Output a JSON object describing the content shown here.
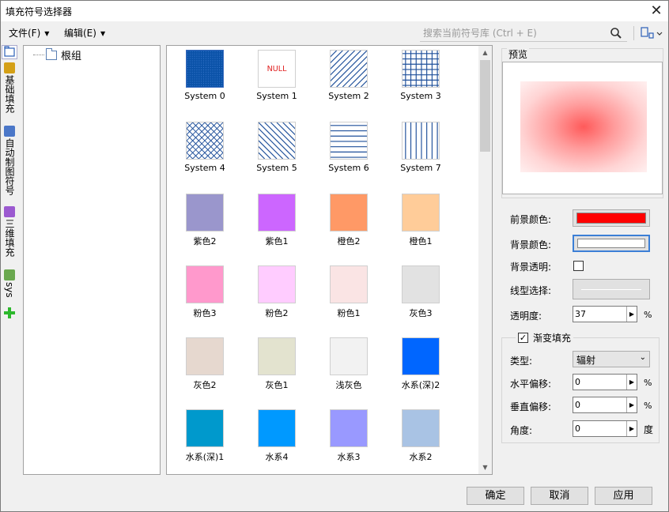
{
  "window": {
    "title": "填充符号选择器",
    "close_glyph": "✕"
  },
  "menu": {
    "file": "文件(F)",
    "edit": "编辑(E)"
  },
  "search": {
    "placeholder": "搜索当前符号库 (Ctrl + E)"
  },
  "vtabs": [
    {
      "label": "基础填充",
      "icon": "pattern-fill-icon",
      "color": "#d4a017"
    },
    {
      "label": "自动制图符号",
      "icon": "map-symbol-icon",
      "color": "#4b77c8"
    },
    {
      "label": "三维填充",
      "icon": "3d-fill-icon",
      "color": "#9b59d0"
    },
    {
      "label": "sys",
      "icon": "system-fill-icon",
      "color": "#6aa84f"
    }
  ],
  "tree": {
    "root": "根组"
  },
  "symbols": [
    {
      "label": "System 0",
      "pattern": "solid-blue-dot",
      "color": "#0a52a8"
    },
    {
      "label": "System 1",
      "pattern": "null",
      "text": "NULL",
      "color": "#e02020"
    },
    {
      "label": "System 2",
      "pattern": "diag-right",
      "color": "#1e4f9a"
    },
    {
      "label": "System 3",
      "pattern": "grid",
      "color": "#1e4f9a"
    },
    {
      "label": "System 4",
      "pattern": "cross-hatch",
      "color": "#1e4f9a"
    },
    {
      "label": "System 5",
      "pattern": "diag-left",
      "color": "#1e4f9a"
    },
    {
      "label": "System 6",
      "pattern": "horizontal",
      "color": "#1e4f9a"
    },
    {
      "label": "System 7",
      "pattern": "vertical",
      "color": "#1e4f9a"
    },
    {
      "label": "紫色2",
      "pattern": "solid",
      "color": "#9a96cc"
    },
    {
      "label": "紫色1",
      "pattern": "solid",
      "color": "#cc66ff"
    },
    {
      "label": "橙色2",
      "pattern": "solid",
      "color": "#ff9966"
    },
    {
      "label": "橙色1",
      "pattern": "solid",
      "color": "#ffcc99"
    },
    {
      "label": "粉色3",
      "pattern": "solid",
      "color": "#ff99cc"
    },
    {
      "label": "粉色2",
      "pattern": "solid",
      "color": "#ffccff"
    },
    {
      "label": "粉色1",
      "pattern": "solid",
      "color": "#fae4e4"
    },
    {
      "label": "灰色3",
      "pattern": "solid",
      "color": "#e2e2e2"
    },
    {
      "label": "灰色2",
      "pattern": "solid",
      "color": "#e6d8cf"
    },
    {
      "label": "灰色1",
      "pattern": "solid",
      "color": "#e3e3cf"
    },
    {
      "label": "浅灰色",
      "pattern": "solid",
      "color": "#f2f2f2"
    },
    {
      "label": "水系(深)2",
      "pattern": "solid",
      "color": "#0066ff"
    },
    {
      "label": "水系(深)1",
      "pattern": "solid",
      "color": "#0099cc"
    },
    {
      "label": "水系4",
      "pattern": "solid",
      "color": "#0099ff"
    },
    {
      "label": "水系3",
      "pattern": "solid",
      "color": "#9999ff"
    },
    {
      "label": "水系2",
      "pattern": "solid",
      "color": "#a9c3e4"
    }
  ],
  "preview": {
    "title": "预览"
  },
  "props": {
    "fg_color_label": "前景颜色:",
    "fg_color": "#ff0000",
    "bg_color_label": "背景颜色:",
    "bg_color": "#ffffff",
    "bg_transparent_label": "背景透明:",
    "bg_transparent": false,
    "line_type_label": "线型选择:",
    "opacity_label": "透明度:",
    "opacity_value": "37",
    "opacity_unit": "%"
  },
  "gradient": {
    "enabled_label": "渐变填充",
    "enabled": true,
    "type_label": "类型:",
    "type_value": "辐射",
    "h_offset_label": "水平偏移:",
    "h_offset_value": "0",
    "h_offset_unit": "%",
    "v_offset_label": "垂直偏移:",
    "v_offset_value": "0",
    "v_offset_unit": "%",
    "angle_label": "角度:",
    "angle_value": "0",
    "angle_unit": "度"
  },
  "buttons": {
    "ok": "确定",
    "cancel": "取消",
    "apply": "应用"
  }
}
